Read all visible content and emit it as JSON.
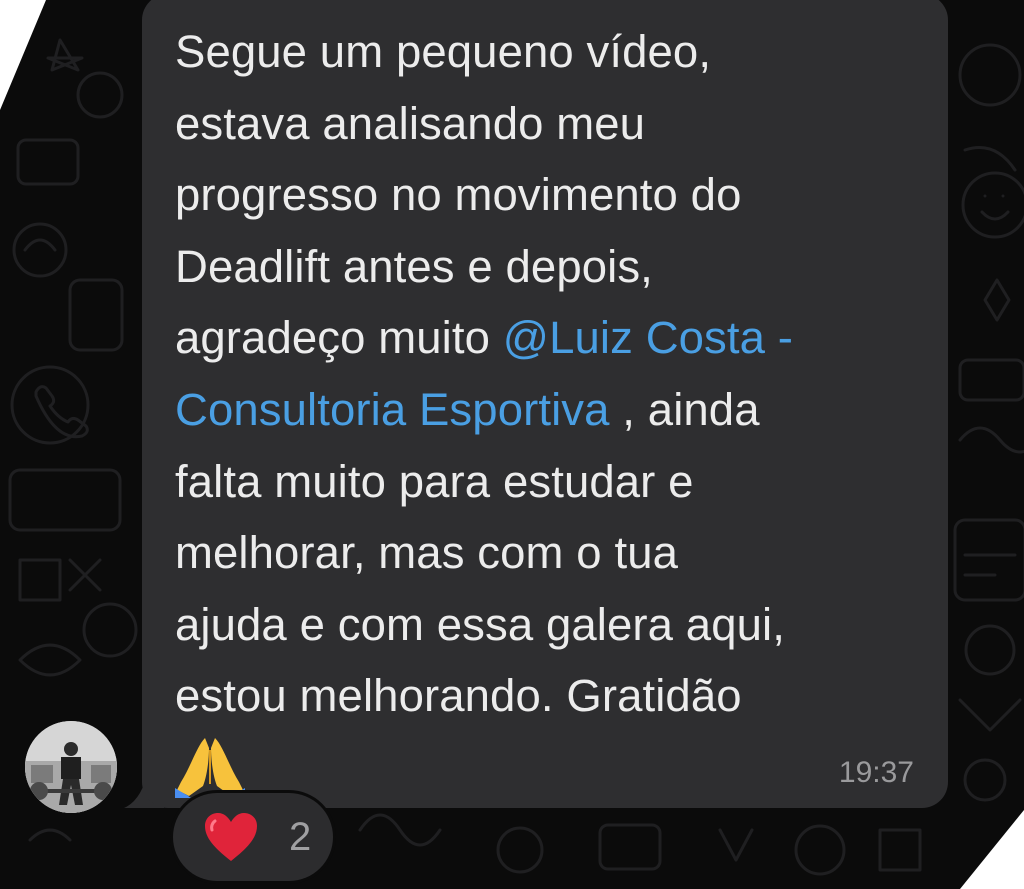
{
  "message": {
    "text_before_mention": "Segue um pequeno vídeo,\nestava analisando meu\nprogresso no movimento do\nDeadlift antes e depois,\nagradeço muito ",
    "mention_at": "@",
    "mention_name": "Luiz Costa -\nConsultoria Esportiva",
    "text_after_mention": " , ainda\nfalta muito para estudar e\nmelhorar, mas com o tua\najuda e com essa galera aqui,\nestou melhorando. Gratidão\n",
    "emoji": "folded-hands-emoji",
    "time": "19:37"
  },
  "reaction": {
    "icon": "red-heart-icon",
    "count": "2"
  },
  "colors": {
    "background": "#0b0b0b",
    "bubble": "#2e2e30",
    "text": "#ececec",
    "mention": "#4a9fe3",
    "timestamp": "#9a9a9c",
    "heart": "#e0243a"
  }
}
